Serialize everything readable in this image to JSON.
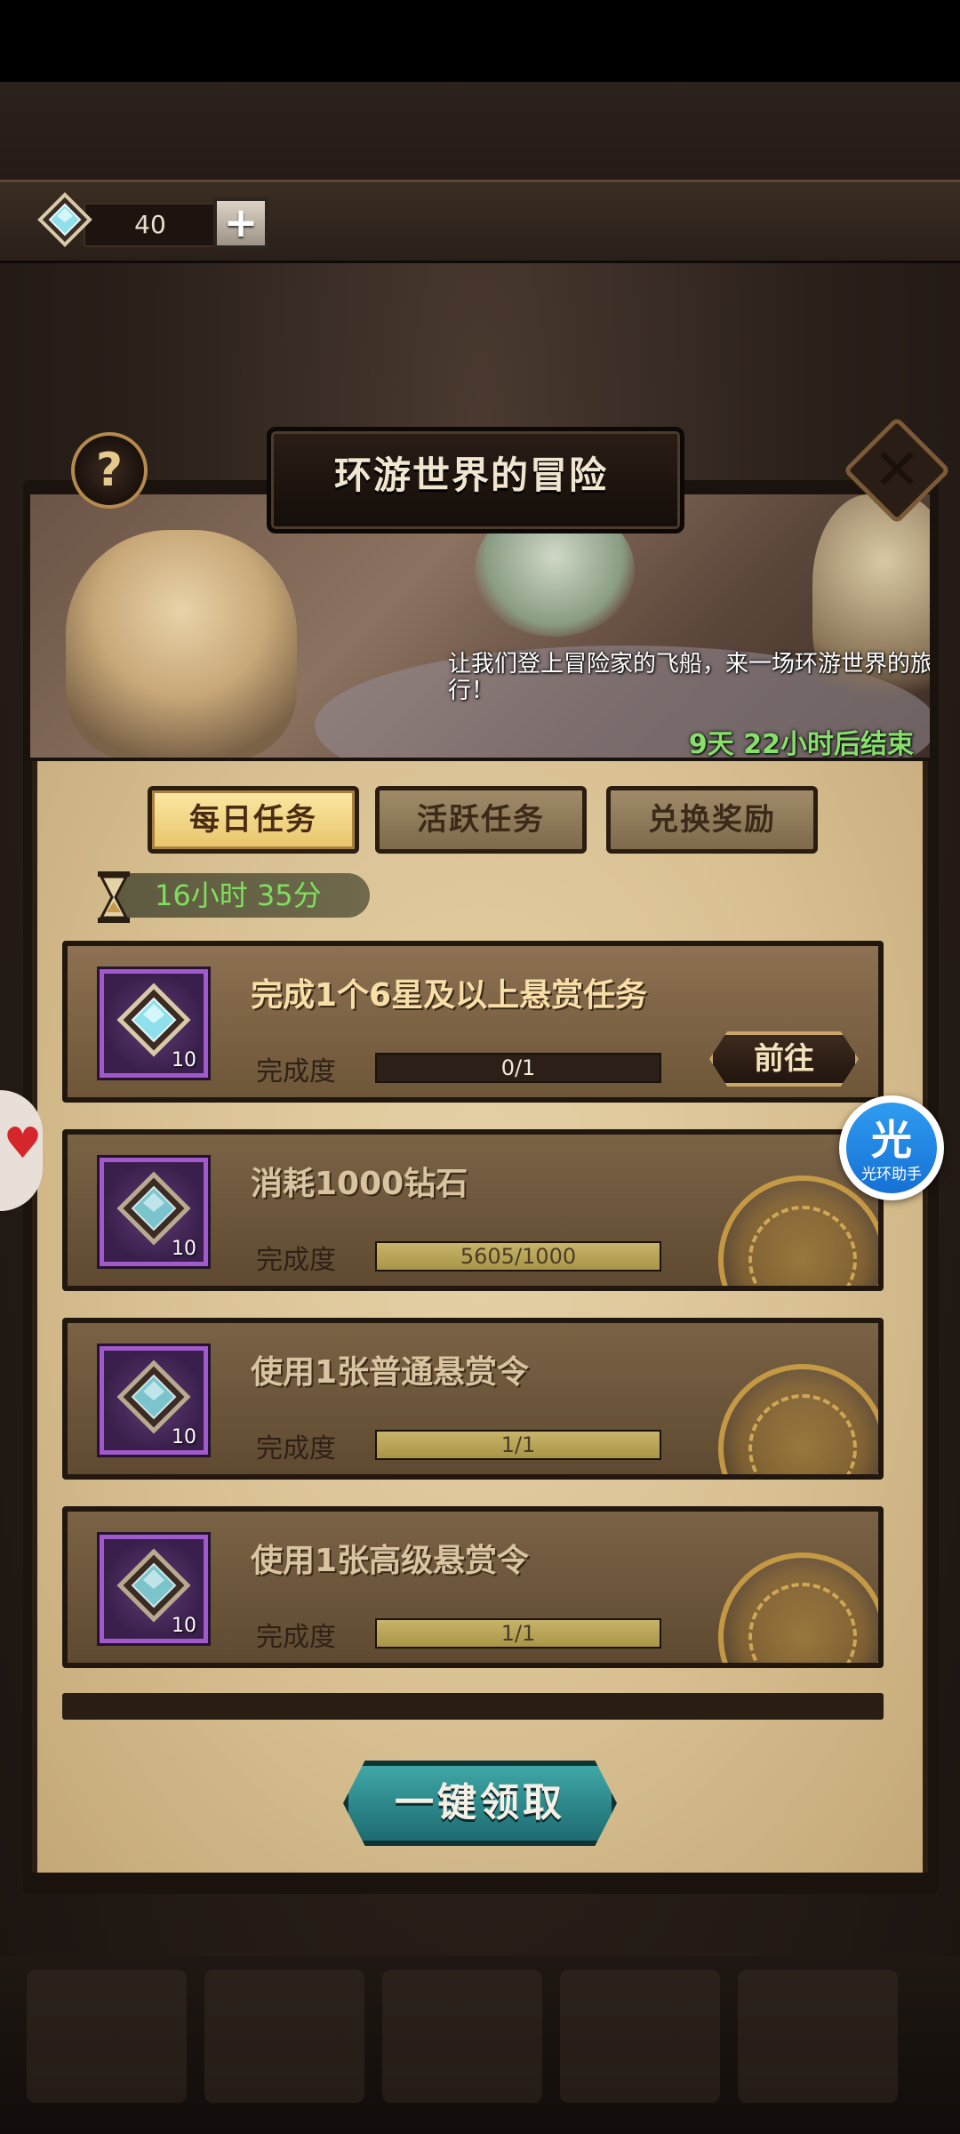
{
  "currency": {
    "icon": "diamond-gem-icon",
    "amount": "40"
  },
  "event": {
    "title": "环游世界的冒险",
    "description": "让我们登上冒险家的飞船，来一场环游世界的旅行！",
    "countdown": "9天 22小时后结束"
  },
  "tabs": [
    {
      "label": "每日任务",
      "active": true
    },
    {
      "label": "活跃任务",
      "active": false
    },
    {
      "label": "兑换奖励",
      "active": false
    }
  ],
  "refresh_timer": "16小时 35分",
  "progress_label": "完成度",
  "tasks": [
    {
      "title": "完成1个6星及以上悬赏任务",
      "reward_count": "10",
      "progress_text": "0/1",
      "progress": 0.0,
      "status": "go",
      "action_label": "前往"
    },
    {
      "title": "消耗1000钻石",
      "reward_count": "10",
      "progress_text": "5605/1000",
      "progress": 1.0,
      "status": "claimed"
    },
    {
      "title": "使用1张普通悬赏令",
      "reward_count": "10",
      "progress_text": "1/1",
      "progress": 1.0,
      "status": "claimed"
    },
    {
      "title": "使用1张高级悬赏令",
      "reward_count": "10",
      "progress_text": "1/1",
      "progress": 1.0,
      "status": "claimed"
    }
  ],
  "claim_all_label": "一键领取",
  "helper": {
    "glyph": "光",
    "label": "光环助手"
  },
  "colors": {
    "accent_gold": "#e8c46a",
    "timer_green": "#7ee05c",
    "reward_purple": "#a15acb",
    "claim_teal": "#2a8a8f"
  }
}
